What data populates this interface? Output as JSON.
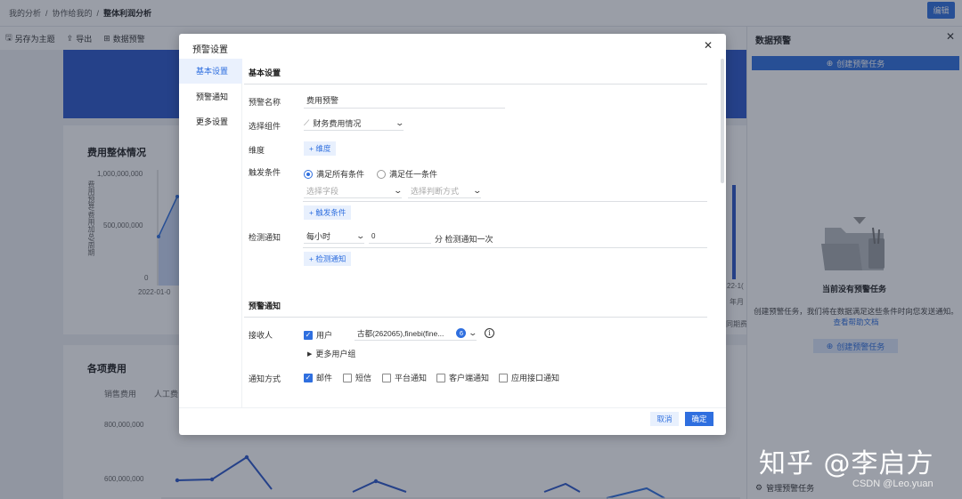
{
  "breadcrumb": {
    "items": [
      "我的分析",
      "协作给我的",
      "整体利润分析"
    ],
    "sep": "/"
  },
  "header": {
    "edit_label": "编辑"
  },
  "toolbar": {
    "save_theme": "另存为主题",
    "export": "导出",
    "data_alert": "数据预警"
  },
  "background": {
    "card1_title": "费用整体情况",
    "card1_yticks": [
      "1,000,000,000",
      "500,000,000",
      "0"
    ],
    "card1_ylabel": "费用预算/费用加总/周期",
    "card1_xtick": "2022-01-0",
    "card2_title": "各项费用",
    "card2_tabs": [
      "销售费用",
      "人工费"
    ],
    "card2_yticks": [
      "800,000,000",
      "600,000,000"
    ],
    "right_fragments": [
      "22-1(",
      "年月",
      "同期费"
    ]
  },
  "panel": {
    "title": "数据预警",
    "create_label": "创建预警任务",
    "empty_title": "当前没有预警任务",
    "empty_desc": "创建预警任务，我们将在数据满足这些条件时向您发送通知。",
    "help_link": "查看帮助文档",
    "create_label2": "创建预警任务",
    "manage_label": "管理预警任务"
  },
  "watermark": {
    "zhihu": "知乎 @李启方",
    "csdn": "CSDN @Leo.yuan"
  },
  "modal": {
    "title": "预警设置",
    "nav": [
      "基本设置",
      "预警通知",
      "更多设置"
    ],
    "basic": {
      "section": "基本设置",
      "name_label": "预警名称",
      "name_value": "费用预警",
      "component_label": "选择组件",
      "component_value": "财务费用情况",
      "dimension_label": "维度",
      "dimension_add": "+ 维度",
      "trigger_label": "触发条件",
      "radio_all": "满足所有条件",
      "radio_any": "满足任一条件",
      "field_placeholder": "选择字段",
      "judge_placeholder": "选择判断方式",
      "trigger_add": "+ 触发条件",
      "check_label": "检测通知",
      "check_freq": "每小时",
      "check_min": "0",
      "check_suffix": "分 检测通知一次",
      "check_add": "+ 检测通知"
    },
    "notify": {
      "section": "预警通知",
      "receiver_label": "接收人",
      "user_label": "用户",
      "receiver_value": "古都(262065),finebi(fine...",
      "receiver_count": "6",
      "more_groups": "更多用户组",
      "method_label": "通知方式",
      "methods": [
        "邮件",
        "短信",
        "平台通知",
        "客户端通知",
        "应用接口通知"
      ],
      "methods_checked": [
        true,
        false,
        false,
        false,
        false
      ]
    },
    "cancel_label": "取消",
    "ok_label": "确定"
  }
}
